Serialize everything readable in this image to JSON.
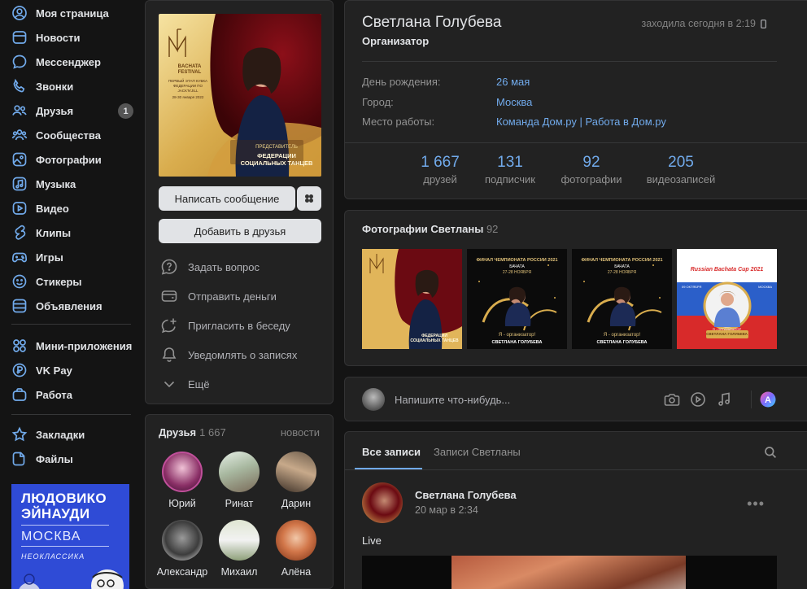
{
  "nav": {
    "items": [
      {
        "label": "Моя страница",
        "icon": "user-circle-icon"
      },
      {
        "label": "Новости",
        "icon": "news-icon"
      },
      {
        "label": "Мессенджер",
        "icon": "message-icon"
      },
      {
        "label": "Звонки",
        "icon": "phone-icon"
      },
      {
        "label": "Друзья",
        "icon": "friends-icon",
        "badge": "1"
      },
      {
        "label": "Сообщества",
        "icon": "communities-icon"
      },
      {
        "label": "Фотографии",
        "icon": "photos-icon"
      },
      {
        "label": "Музыка",
        "icon": "music-icon"
      },
      {
        "label": "Видео",
        "icon": "video-icon"
      },
      {
        "label": "Клипы",
        "icon": "clips-icon"
      },
      {
        "label": "Игры",
        "icon": "gamepad-icon"
      },
      {
        "label": "Стикеры",
        "icon": "sticker-icon"
      },
      {
        "label": "Объявления",
        "icon": "classifieds-icon"
      },
      {
        "label": "Мини-приложения",
        "icon": "apps-icon"
      },
      {
        "label": "VK Pay",
        "icon": "vkpay-icon"
      },
      {
        "label": "Работа",
        "icon": "briefcase-icon"
      },
      {
        "label": "Закладки",
        "icon": "star-icon"
      },
      {
        "label": "Файлы",
        "icon": "file-icon"
      }
    ],
    "ad": {
      "title": "ЛЮДОВИКО ЭЙНАУДИ",
      "city": "МОСКВА",
      "genre": "НЕОКЛАССИКА"
    }
  },
  "profile": {
    "name": "Светлана Голубева",
    "status": "Организатор",
    "online": "заходила сегодня в 2:19",
    "birthday_label": "День рождения:",
    "birthday": "26 мая",
    "city_label": "Город:",
    "city": "Москва",
    "work_label": "Место работы:",
    "work": "Команда Дом.ру | Работа в Дом.ру",
    "stats": [
      {
        "value": "1 667",
        "label": "друзей"
      },
      {
        "value": "131",
        "label": "подписчик"
      },
      {
        "value": "92",
        "label": "фотографии"
      },
      {
        "value": "205",
        "label": "видеозаписей"
      }
    ]
  },
  "avatar": {
    "logo_text": "BACHATA FESTIVAL",
    "stage_text": "ПЕРВЫЙ ЭТАП КУБКА ФЕДЕРАЦИИ ПО JACK'N'JILL",
    "date_text": "28-30 января 2022",
    "rep_label": "ПРЕДСТАВИТЕЛЬ",
    "rep_org": "ФЕДЕРАЦИИ СОЦИАЛЬНЫХ ТАНЦЕВ"
  },
  "actions": {
    "message_btn": "Написать сообщение",
    "add_friend_btn": "Добавить в друзья",
    "list": [
      {
        "label": "Задать вопрос",
        "icon": "question-icon"
      },
      {
        "label": "Отправить деньги",
        "icon": "money-icon"
      },
      {
        "label": "Пригласить в беседу",
        "icon": "invite-chat-icon"
      },
      {
        "label": "Уведомлять о записях",
        "icon": "bell-icon"
      },
      {
        "label": "Ещё",
        "icon": "chevron-down-icon"
      }
    ]
  },
  "friends": {
    "title": "Друзья",
    "count": "1 667",
    "news": "новости",
    "list": [
      "Юрий",
      "Ринат",
      "Дарин",
      "Александр",
      "Михаил",
      "Алёна"
    ]
  },
  "photos": {
    "title": "Фотографии Светланы",
    "count": "92",
    "items": [
      {
        "caption": "ФЕДЕРАЦИИ СОЦИАЛЬНЫХ ТАНЦЕВ"
      },
      {
        "caption": "ФИНАЛ ЧЕМПИОНАТА РОССИИ 2021",
        "sub": "БАЧАТА",
        "date": "27-28 НОЯБРЯ",
        "role": "Я - организатор!",
        "person": "СВЕТЛАНА ГОЛУБЕВА"
      },
      {
        "caption": "ФИНАЛ ЧЕМПИОНАТА РОССИИ 2021",
        "sub": "БАЧАТА",
        "date": "27-28 НОЯБРЯ",
        "role": "Я - организатор!",
        "person": "СВЕТЛАНА ГОЛУБЕВА"
      },
      {
        "caption": "Russian Bachata Cup 2021",
        "date": "09 ОКТЯБРЯ",
        "city": "МОСКВА",
        "role": "Я - ОРГАНИЗАТОР",
        "person": "СВЕТЛАНА ГОЛУБЕВА"
      }
    ]
  },
  "composer": {
    "placeholder": "Напишите что-нибудь..."
  },
  "feed": {
    "tabs": [
      "Все записи",
      "Записи Светланы"
    ],
    "post": {
      "author": "Светлана Голубева",
      "date": "20 мар в 2:34",
      "text": "Live"
    }
  }
}
